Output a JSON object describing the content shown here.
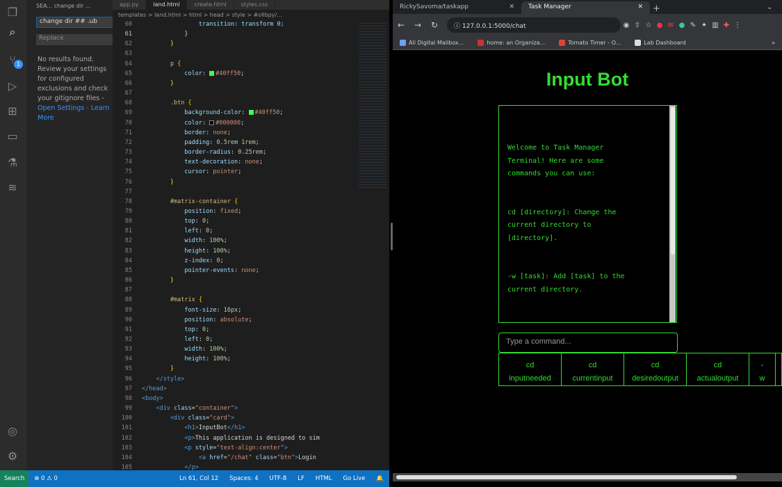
{
  "vscode": {
    "sidebar_header": "SEA... change dir ...",
    "search_value": "change dir ## .ub",
    "replace_placeholder": "Replace",
    "no_results": "No results found. Review your settings for configured exclusions and check your gitignore files - ",
    "open_settings": "Open Settings",
    "learn_more": " - Learn More",
    "tabs": [
      "app.py",
      "land.html",
      "create.html",
      "styles.css"
    ],
    "breadcrumb": "templates > land.html > html > head > style > #ollbpy/...",
    "status": {
      "remote": "Search",
      "errors": "⊗ 0 ⚠ 0",
      "cursor": "Ln 61, Col 12",
      "spaces": "Spaces: 4",
      "encoding": "UTF-8",
      "eol": "LF",
      "language": "HTML",
      "golive": "Go Live"
    }
  },
  "code_lines": [
    {
      "n": "60",
      "t": [
        [
          "",
          "                "
        ],
        [
          "tok-prop",
          "transition: transform 0;"
        ]
      ]
    },
    {
      "n": "61",
      "t": [
        [
          "",
          "            }"
        ]
      ]
    },
    {
      "n": "62",
      "t": [
        [
          "tok-brace",
          "        }"
        ]
      ]
    },
    {
      "n": "63",
      "t": [
        [
          "",
          ""
        ]
      ]
    },
    {
      "n": "64",
      "t": [
        [
          "tok-sel",
          "        p "
        ],
        [
          "tok-brace",
          "{"
        ]
      ]
    },
    {
      "n": "65",
      "t": [
        [
          "tok-prop",
          "            color"
        ],
        [
          "",
          ": "
        ],
        [
          "swatch",
          ""
        ],
        [
          "tok-val",
          "#40ff50"
        ],
        [
          "",
          ";"
        ]
      ]
    },
    {
      "n": "66",
      "t": [
        [
          "tok-brace",
          "        }"
        ]
      ]
    },
    {
      "n": "67",
      "t": [
        [
          "",
          ""
        ]
      ]
    },
    {
      "n": "68",
      "t": [
        [
          "tok-sel",
          "        .btn "
        ],
        [
          "tok-brace",
          "{"
        ]
      ]
    },
    {
      "n": "69",
      "t": [
        [
          "tok-prop",
          "            background-color"
        ],
        [
          "",
          ": "
        ],
        [
          "swatch",
          ""
        ],
        [
          "tok-val",
          "#40ff50"
        ],
        [
          "",
          ";"
        ]
      ]
    },
    {
      "n": "70",
      "t": [
        [
          "tok-prop",
          "            color"
        ],
        [
          "",
          ": "
        ],
        [
          "swatch black",
          ""
        ],
        [
          "tok-val",
          "#000000"
        ],
        [
          "",
          ";"
        ]
      ]
    },
    {
      "n": "71",
      "t": [
        [
          "tok-prop",
          "            border"
        ],
        [
          "",
          ": "
        ],
        [
          "tok-val",
          "none"
        ],
        [
          "",
          ";"
        ]
      ]
    },
    {
      "n": "72",
      "t": [
        [
          "tok-prop",
          "            padding"
        ],
        [
          "",
          ": "
        ],
        [
          "tok-num",
          "0.5rem 1rem"
        ],
        [
          "",
          ";"
        ]
      ]
    },
    {
      "n": "73",
      "t": [
        [
          "tok-prop",
          "            border-radius"
        ],
        [
          "",
          ": "
        ],
        [
          "tok-num",
          "0.25rem"
        ],
        [
          "",
          ";"
        ]
      ]
    },
    {
      "n": "74",
      "t": [
        [
          "tok-prop",
          "            text-decoration"
        ],
        [
          "",
          ": "
        ],
        [
          "tok-val",
          "none"
        ],
        [
          "",
          ";"
        ]
      ]
    },
    {
      "n": "75",
      "t": [
        [
          "tok-prop",
          "            cursor"
        ],
        [
          "",
          ": "
        ],
        [
          "tok-val",
          "pointer"
        ],
        [
          "",
          ";"
        ]
      ]
    },
    {
      "n": "76",
      "t": [
        [
          "tok-brace",
          "        }"
        ]
      ]
    },
    {
      "n": "77",
      "t": [
        [
          "",
          ""
        ]
      ]
    },
    {
      "n": "78",
      "t": [
        [
          "tok-sel",
          "        #matrix-container "
        ],
        [
          "tok-brace",
          "{"
        ]
      ]
    },
    {
      "n": "79",
      "t": [
        [
          "tok-prop",
          "            position"
        ],
        [
          "",
          ": "
        ],
        [
          "tok-val",
          "fixed"
        ],
        [
          "",
          ";"
        ]
      ]
    },
    {
      "n": "80",
      "t": [
        [
          "tok-prop",
          "            top"
        ],
        [
          "",
          ": "
        ],
        [
          "tok-num",
          "0"
        ],
        [
          "",
          ";"
        ]
      ]
    },
    {
      "n": "81",
      "t": [
        [
          "tok-prop",
          "            left"
        ],
        [
          "",
          ": "
        ],
        [
          "tok-num",
          "0"
        ],
        [
          "",
          ";"
        ]
      ]
    },
    {
      "n": "82",
      "t": [
        [
          "tok-prop",
          "            width"
        ],
        [
          "",
          ": "
        ],
        [
          "tok-num",
          "100%"
        ],
        [
          "",
          ";"
        ]
      ]
    },
    {
      "n": "83",
      "t": [
        [
          "tok-prop",
          "            height"
        ],
        [
          "",
          ": "
        ],
        [
          "tok-num",
          "100%"
        ],
        [
          "",
          ";"
        ]
      ]
    },
    {
      "n": "84",
      "t": [
        [
          "tok-prop",
          "            z-index"
        ],
        [
          "",
          ": "
        ],
        [
          "tok-num",
          "0"
        ],
        [
          "",
          ";"
        ]
      ]
    },
    {
      "n": "85",
      "t": [
        [
          "tok-prop",
          "            pointer-events"
        ],
        [
          "",
          ": "
        ],
        [
          "tok-val",
          "none"
        ],
        [
          "",
          ";"
        ]
      ]
    },
    {
      "n": "86",
      "t": [
        [
          "tok-brace",
          "        }"
        ]
      ]
    },
    {
      "n": "87",
      "t": [
        [
          "",
          ""
        ]
      ]
    },
    {
      "n": "88",
      "t": [
        [
          "tok-sel",
          "        #matrix "
        ],
        [
          "tok-brace",
          "{"
        ]
      ]
    },
    {
      "n": "89",
      "t": [
        [
          "tok-prop",
          "            font-size"
        ],
        [
          "",
          ": "
        ],
        [
          "tok-num",
          "16px"
        ],
        [
          "",
          ";"
        ]
      ]
    },
    {
      "n": "90",
      "t": [
        [
          "tok-prop",
          "            position"
        ],
        [
          "",
          ": "
        ],
        [
          "tok-val",
          "absolute"
        ],
        [
          "",
          ";"
        ]
      ]
    },
    {
      "n": "91",
      "t": [
        [
          "tok-prop",
          "            top"
        ],
        [
          "",
          ": "
        ],
        [
          "tok-num",
          "0"
        ],
        [
          "",
          ";"
        ]
      ]
    },
    {
      "n": "92",
      "t": [
        [
          "tok-prop",
          "            left"
        ],
        [
          "",
          ": "
        ],
        [
          "tok-num",
          "0"
        ],
        [
          "",
          ";"
        ]
      ]
    },
    {
      "n": "93",
      "t": [
        [
          "tok-prop",
          "            width"
        ],
        [
          "",
          ": "
        ],
        [
          "tok-num",
          "100%"
        ],
        [
          "",
          ";"
        ]
      ]
    },
    {
      "n": "94",
      "t": [
        [
          "tok-prop",
          "            height"
        ],
        [
          "",
          ": "
        ],
        [
          "tok-num",
          "100%"
        ],
        [
          "",
          ";"
        ]
      ]
    },
    {
      "n": "95",
      "t": [
        [
          "tok-brace",
          "        }"
        ]
      ]
    },
    {
      "n": "96",
      "t": [
        [
          "tok-tag",
          "    </style>"
        ]
      ]
    },
    {
      "n": "97",
      "t": [
        [
          "tok-tag",
          "</head>"
        ]
      ]
    },
    {
      "n": "98",
      "t": [
        [
          "tok-tag",
          "<body>"
        ]
      ]
    },
    {
      "n": "99",
      "t": [
        [
          "tok-tag",
          "    <div "
        ],
        [
          "tok-attr",
          "class"
        ],
        [
          "",
          "="
        ],
        [
          "tok-val",
          "\"container\""
        ],
        [
          "tok-tag",
          ">"
        ]
      ]
    },
    {
      "n": "100",
      "t": [
        [
          "tok-tag",
          "        <div "
        ],
        [
          "tok-attr",
          "class"
        ],
        [
          "",
          "="
        ],
        [
          "tok-val",
          "\"card\""
        ],
        [
          "tok-tag",
          ">"
        ]
      ]
    },
    {
      "n": "101",
      "t": [
        [
          "tok-tag",
          "            <h1>"
        ],
        [
          "",
          "InputBot"
        ],
        [
          "tok-tag",
          "</h1>"
        ]
      ]
    },
    {
      "n": "102",
      "t": [
        [
          "tok-tag",
          "            <p>"
        ],
        [
          "",
          "This application is designed to sim"
        ]
      ]
    },
    {
      "n": "103",
      "t": [
        [
          "tok-tag",
          "            <p "
        ],
        [
          "tok-attr",
          "style"
        ],
        [
          "",
          "="
        ],
        [
          "tok-val",
          "\"text-align:center\""
        ],
        [
          "tok-tag",
          ">"
        ]
      ]
    },
    {
      "n": "104",
      "t": [
        [
          "tok-tag",
          "                <a "
        ],
        [
          "tok-attr",
          "href"
        ],
        [
          "",
          "="
        ],
        [
          "tok-val",
          "\"/chat\""
        ],
        [
          "tok-attr",
          " class"
        ],
        [
          "",
          "="
        ],
        [
          "tok-val",
          "\"btn\""
        ],
        [
          "tok-tag",
          ">"
        ],
        [
          "",
          "Login"
        ]
      ]
    },
    {
      "n": "105",
      "t": [
        [
          "tok-tag",
          "            </p>"
        ]
      ]
    }
  ],
  "browser": {
    "tabs": [
      "RickySavoma/taskapp",
      "Task Manager"
    ],
    "url": "127.0.0.1:5000/chat",
    "bookmarks": [
      "All Digital Mailbox...",
      "home: an Organiza...",
      "Tomato Timer - O...",
      "Lab Dashboard"
    ],
    "page_title": "Input Bot",
    "terminal_text": "Welcome to Task Manager\nTerminal! Here are some\ncommands you can use:\n\n\ncd [directory]: Change the\ncurrent directory to\n[directory].\n\n\n-w [task]: Add [task] to the\ncurrent directory.",
    "input_placeholder": "Type a command...",
    "command_buttons": [
      {
        "line1": "cd",
        "line2": "inputneeded"
      },
      {
        "line1": "cd",
        "line2": "currentinput"
      },
      {
        "line1": "cd",
        "line2": "desiredoutput"
      },
      {
        "line1": "cd",
        "line2": "actualoutput"
      },
      {
        "line1": "-",
        "line2": "w"
      }
    ],
    "accent_color": "#33dd33"
  }
}
